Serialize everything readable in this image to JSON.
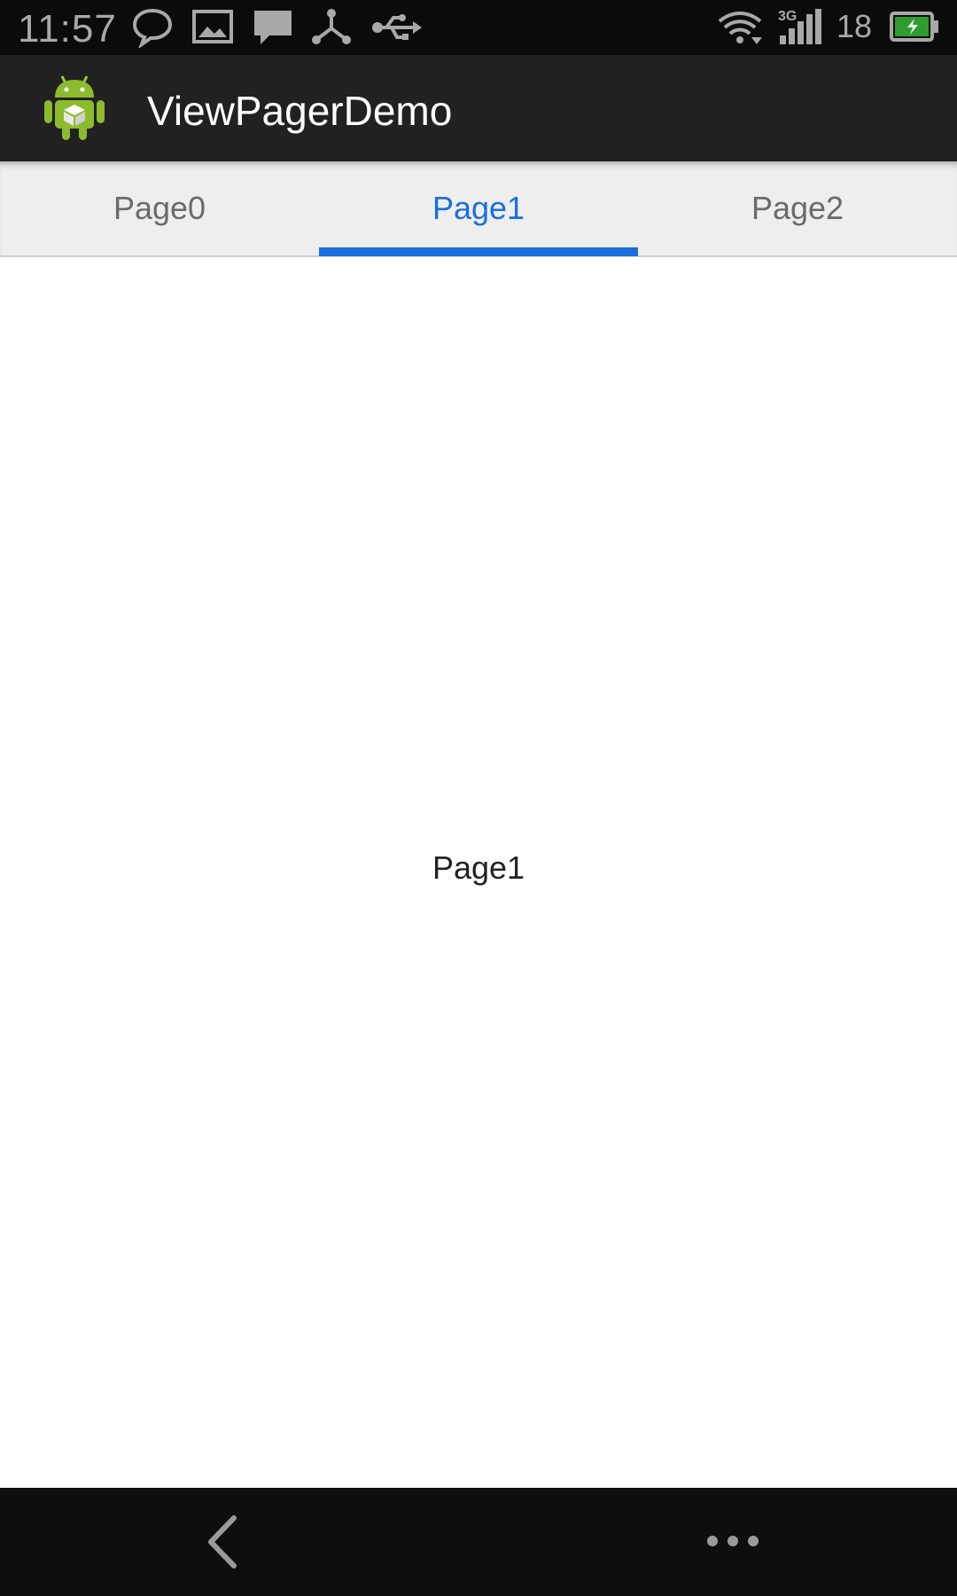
{
  "status_bar": {
    "time": "11:57",
    "network_type": "3G",
    "battery_level": "18",
    "icons": [
      "chat-bubble-icon",
      "image-icon",
      "message-icon",
      "share-icon",
      "usb-icon",
      "wifi-icon",
      "signal-icon",
      "battery-charging-icon"
    ]
  },
  "action_bar": {
    "title": "ViewPagerDemo",
    "icon": "android-app-icon"
  },
  "tabs": [
    {
      "label": "Page0",
      "selected": false
    },
    {
      "label": "Page1",
      "selected": true
    },
    {
      "label": "Page2",
      "selected": false
    }
  ],
  "content": {
    "page_label": "Page1"
  },
  "nav_bar": {
    "icons": [
      "back-icon",
      "overflow-menu-icon"
    ]
  },
  "colors": {
    "accent": "#1a6fdf",
    "action_bar": "#212121",
    "status_bar": "#0b0b0b"
  }
}
